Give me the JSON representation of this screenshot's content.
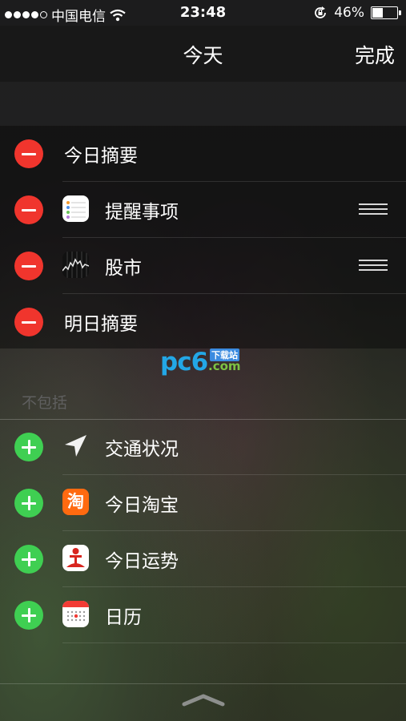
{
  "status_bar": {
    "carrier": "中国电信",
    "time": "23:48",
    "battery_percent": "46%",
    "battery_level": 0.46
  },
  "navbar": {
    "title": "今天",
    "done_label": "完成"
  },
  "included": [
    {
      "label": "今日摘要",
      "icon": null,
      "draggable": false
    },
    {
      "label": "提醒事项",
      "icon": "reminders-app-icon",
      "draggable": true
    },
    {
      "label": "股市",
      "icon": "stocks-app-icon",
      "draggable": true
    },
    {
      "label": "明日摘要",
      "icon": null,
      "draggable": false
    }
  ],
  "excluded_header": "不包括",
  "excluded": [
    {
      "label": "交通状况",
      "icon": "location-arrow-icon"
    },
    {
      "label": "今日淘宝",
      "icon": "taobao-app-icon",
      "icon_text": "淘"
    },
    {
      "label": "今日运势",
      "icon": "fortune-app-icon"
    },
    {
      "label": "日历",
      "icon": "calendar-app-icon"
    }
  ],
  "watermark": {
    "brand": "pc6",
    "badge": "下载站",
    "domain": ".com"
  },
  "colors": {
    "remove": "#f0352d",
    "add": "#3fcf52",
    "taobao": "#ff6a10"
  }
}
